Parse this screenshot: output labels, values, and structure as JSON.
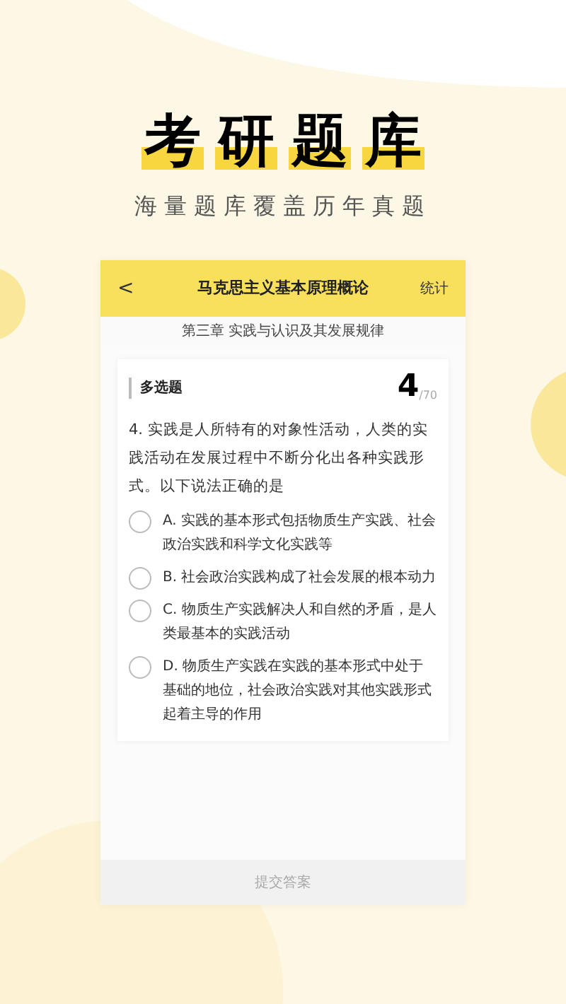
{
  "promo": {
    "title": "考研题库",
    "subtitle": "海量题库覆盖历年真题"
  },
  "header": {
    "back": "<",
    "title": "马克思主义基本原理概论",
    "action": "统计"
  },
  "chapter": "第三章 实践与认识及其发展规律",
  "question": {
    "type": "多选题",
    "number": "4",
    "total": "/70",
    "text": "4. 实践是人所特有的对象性活动，人类的实践活动在发展过程中不断分化出各种实践形式。以下说法正确的是",
    "options": [
      {
        "text": "A. 实践的基本形式包括物质生产实践、社会政治实践和科学文化实践等",
        "selected": false
      },
      {
        "text": "B. 社会政治实践构成了社会发展的根本动力",
        "selected": false
      },
      {
        "text": "C. 物质生产实践解决人和自然的矛盾，是人类最基本的实践活动",
        "selected": false
      },
      {
        "text": "D. 物质生产实践在实践的基本形式中处于基础的地位，社会政治实践对其他实践形式起着主导的作用",
        "selected": false
      }
    ]
  },
  "submit": {
    "label": "提交答案",
    "disabled": true
  }
}
